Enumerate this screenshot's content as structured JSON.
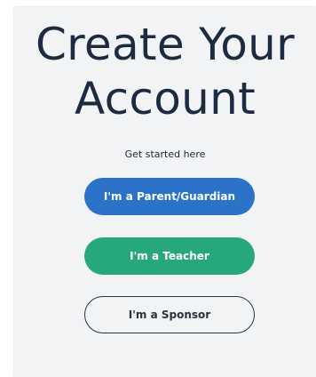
{
  "heading": {
    "title_line1": "Create Your",
    "title_line2": "Account",
    "subtitle": "Get started here"
  },
  "buttons": {
    "parent_label": "I'm a Parent/Guardian",
    "teacher_label": "I'm a Teacher",
    "sponsor_label": "I'm a Sponsor"
  },
  "colors": {
    "title_text": "#1c2b40",
    "parent_button": "#2a73c8",
    "teacher_button": "#27a87b",
    "sponsor_border": "#2d3440",
    "card_background": "#f2f3f4"
  }
}
